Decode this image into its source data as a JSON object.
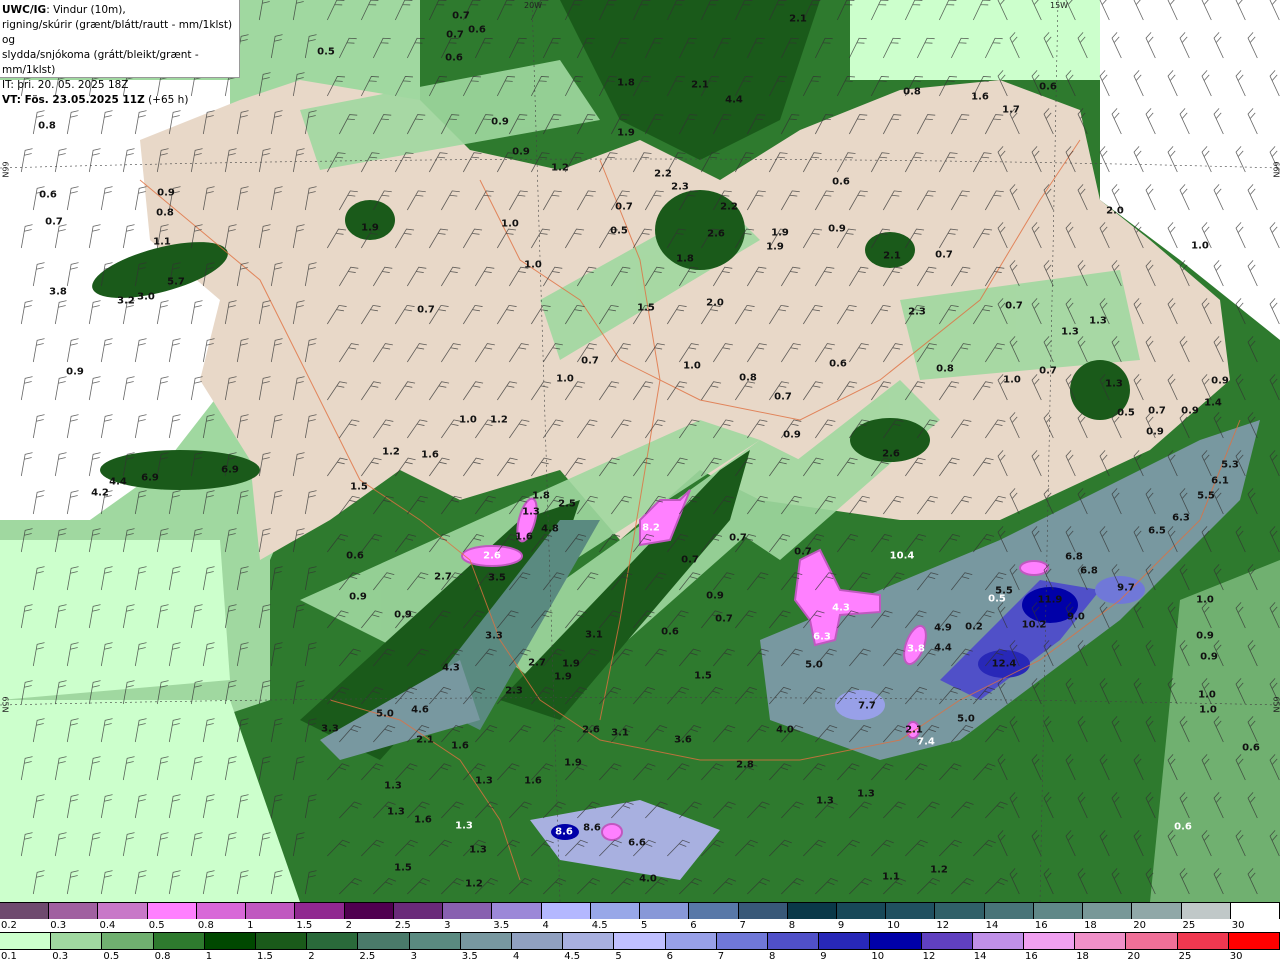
{
  "title": {
    "product": "UWC/IG",
    "line1_rest": ": Vindur (10m),",
    "line2": "rigning/skúrir (grænt/blátt/rautt - mm/1klst) og",
    "line3": "slydda/snjókoma (grátt/bleikt/grænt - mm/1klst)",
    "it": "IT: þri. 20. 05. 2025 18Z",
    "vt": "VT: Fös. 23.05.2025 11Z",
    "vt_offset": "(+65 h)"
  },
  "grid_labels": {
    "lon_20w": "20W",
    "lon_15w": "15W",
    "lat_66n_left": "66N",
    "lat_65n_left": "65N",
    "lat_66n_right": "66N",
    "lat_65n_right": "65N"
  },
  "map": {
    "labels": [
      "0.7",
      "2.1",
      "0.5",
      "0.6",
      "0.7",
      "0.6",
      "1.8",
      "2.1",
      "4.4",
      "0.8",
      "1.6",
      "1.7",
      "0.6",
      "0.8",
      "0.9",
      "1.9",
      "0.9",
      "1.2",
      "2.2",
      "2.3",
      "0.6",
      "0.9",
      "0.8",
      "0.7",
      "1.9",
      "1.0",
      "0.7",
      "0.5",
      "2.2",
      "2.6",
      "1.9",
      "1.9",
      "0.9",
      "0.6",
      "2.0",
      "1.0",
      "1.1",
      "5.7",
      "3.8",
      "3.2",
      "3.0",
      "1.0",
      "1.8",
      "2.1",
      "0.7",
      "2.0",
      "2.3",
      "0.7",
      "1.3",
      "1.3",
      "0.7",
      "1.5",
      "0.9",
      "0.7",
      "1.0",
      "1.0",
      "0.8",
      "0.6",
      "0.8",
      "1.0",
      "0.7",
      "1.3",
      "0.9",
      "1.4",
      "0.5",
      "0.7",
      "0.9",
      "0.9",
      "0.7",
      "0.9",
      "1.0",
      "1.2",
      "1.2",
      "1.6",
      "2.6",
      "6.9",
      "4.4",
      "6.9",
      "4.2",
      "1.5",
      "1.8",
      "2.5",
      "1.3",
      "4.8",
      "1.6",
      "2.6",
      "3.5",
      "2.7",
      "0.6",
      "8.2",
      "0.7",
      "0.7",
      "0.7",
      "10.4",
      "6.8",
      "6.8",
      "5.5",
      "0.5",
      "11.9",
      "9.7",
      "9.0",
      "0.2",
      "10.2",
      "4.9",
      "4.4",
      "3.8",
      "6.3",
      "4.3",
      "0.9",
      "0.9",
      "0.9",
      "0.7",
      "0.6",
      "3.3",
      "3.1",
      "1.9",
      "2.7",
      "1.9",
      "4.3",
      "5.0",
      "12.4",
      "6.5",
      "6.3",
      "5.5",
      "6.1",
      "5.3",
      "1.0",
      "0.9",
      "0.9",
      "1.0",
      "1.0",
      "1.5",
      "2.3",
      "5.0",
      "4.6",
      "7.7",
      "5.0",
      "4.0",
      "2.1",
      "7.4",
      "3.3",
      "2.1",
      "2.6",
      "3.1",
      "3.6",
      "1.6",
      "0.6",
      "1.9",
      "2.8",
      "1.3",
      "1.6",
      "1.3",
      "1.3",
      "1.3",
      "1.6",
      "1.3",
      "0.6",
      "8.6",
      "8.6",
      "6.6",
      "1.3",
      "1.5",
      "1.1",
      "1.2",
      "4.0",
      "1.2",
      "1.3"
    ],
    "colors": {
      "land_dry": "#e8d8c8",
      "rain_light": "#ccffcc",
      "rain_mid": "#70b070",
      "rain_dark": "#1a5a1a",
      "snow_blue": "#9898e0",
      "snow_purple": "#ff80ff",
      "roads": "#e07040"
    }
  },
  "legend": {
    "snow": {
      "ticks": [
        "0.2",
        "0.3",
        "0.4",
        "0.5",
        "0.8",
        "1",
        "1.5",
        "2",
        "2.5",
        "3",
        "3.5",
        "4",
        "4.5",
        "5",
        "6",
        "7",
        "8",
        "9",
        "10",
        "12",
        "14",
        "16",
        "18",
        "20",
        "25",
        "30"
      ],
      "colors": [
        "#6e4a6e",
        "#a060a0",
        "#c878c8",
        "#ff80ff",
        "#d868d8",
        "#c058c0",
        "#902890",
        "#500050",
        "#6a2a7a",
        "#8860b0",
        "#9c88d8",
        "#b4b8ff",
        "#98a8e8",
        "#8898d8",
        "#5878a8",
        "#385878",
        "#0a3848",
        "#184858",
        "#205060",
        "#306068",
        "#487478",
        "#608888",
        "#789898",
        "#90a8a8",
        "#c0c8c8",
        "#ffffff"
      ]
    },
    "rain": {
      "ticks": [
        "0.1",
        "0.3",
        "0.5",
        "0.8",
        "1",
        "1.5",
        "2",
        "2.5",
        "3",
        "3.5",
        "4",
        "4.5",
        "5",
        "6",
        "7",
        "8",
        "9",
        "10",
        "12",
        "14",
        "16",
        "18",
        "20",
        "25",
        "30"
      ],
      "colors": [
        "#ccffcc",
        "#a0d8a0",
        "#70b070",
        "#2e7a2e",
        "#004800",
        "#1a5a1a",
        "#2a6a3a",
        "#4a7a6a",
        "#5a8a80",
        "#7898a0",
        "#90a0c0",
        "#a8b0e0",
        "#c0c0ff",
        "#98a0e8",
        "#7078d8",
        "#5050c8",
        "#2828b8",
        "#0000a8",
        "#6040c0",
        "#c090e8",
        "#f0a0f0",
        "#f090c8",
        "#f07098",
        "#f03850",
        "#ff0000"
      ]
    }
  }
}
